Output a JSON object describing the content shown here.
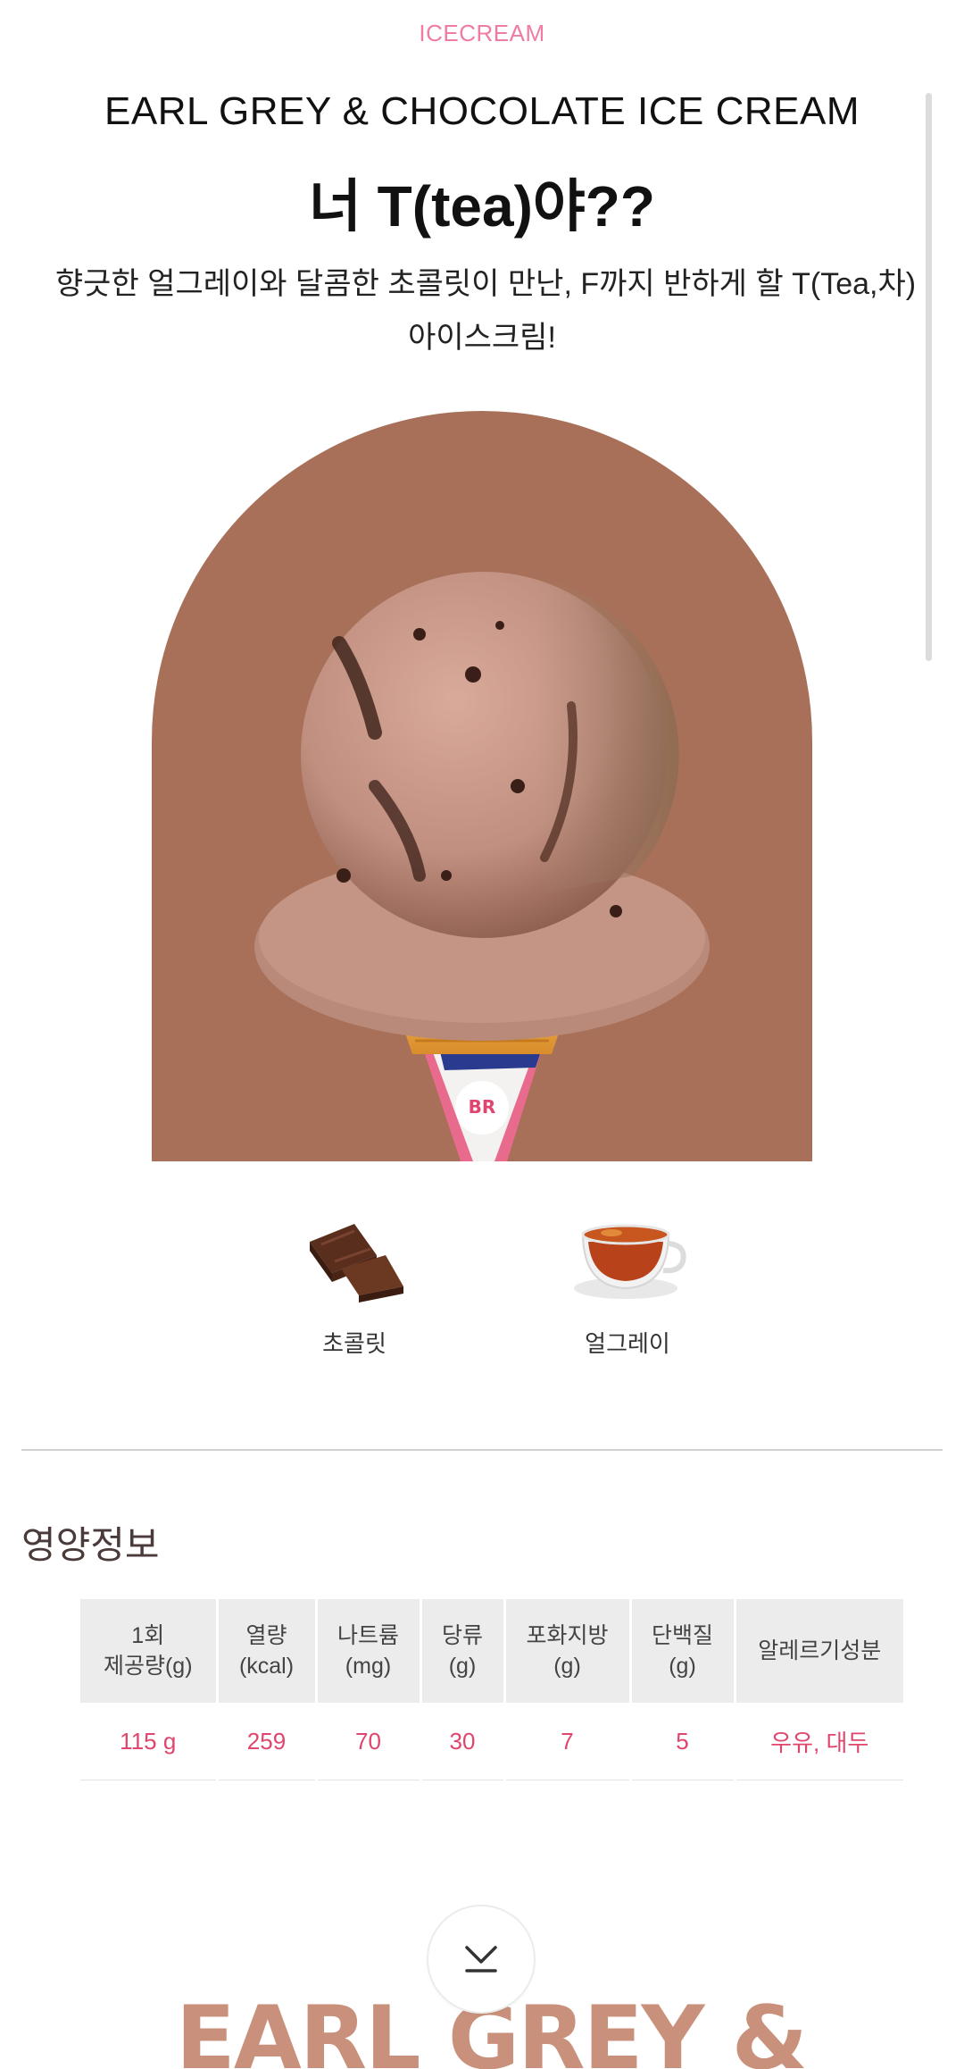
{
  "header": {
    "category": "ICECREAM"
  },
  "product": {
    "name_en": "EARL GREY & CHOCOLATE ICE CREAM",
    "headline": "너 T(tea)야??",
    "description_line1": "향긋한 얼그레이와 달콤한 초콜릿이 만난, F까지 반하게 할 T(Tea,차)",
    "description_line2": "아이스크림!",
    "hero_background_color": "#a87058",
    "hero_image": "ice-cream-cone-image"
  },
  "ingredients": [
    {
      "label": "초콜릿",
      "icon": "chocolate-icon"
    },
    {
      "label": "얼그레이",
      "icon": "tea-cup-icon"
    }
  ],
  "nutrition": {
    "title": "영양정보",
    "headers": [
      [
        "1회",
        "제공량(g)"
      ],
      [
        "열량",
        "(kcal)"
      ],
      [
        "나트륨",
        "(mg)"
      ],
      [
        "당류",
        "(g)"
      ],
      [
        "포화지방",
        "(g)"
      ],
      [
        "단백질",
        "(g)"
      ],
      [
        "알레르기성분"
      ]
    ],
    "values": [
      "115 g",
      "259",
      "70",
      "30",
      "7",
      "5",
      "우유, 대두"
    ],
    "value_color": "#e0456d"
  },
  "footer": {
    "banner_text": "EARL GREY &",
    "scroll_button_icon": "chevron-down-icon"
  },
  "colors": {
    "accent_pink": "#f07ca3",
    "banner_brown": "#c9917b"
  }
}
